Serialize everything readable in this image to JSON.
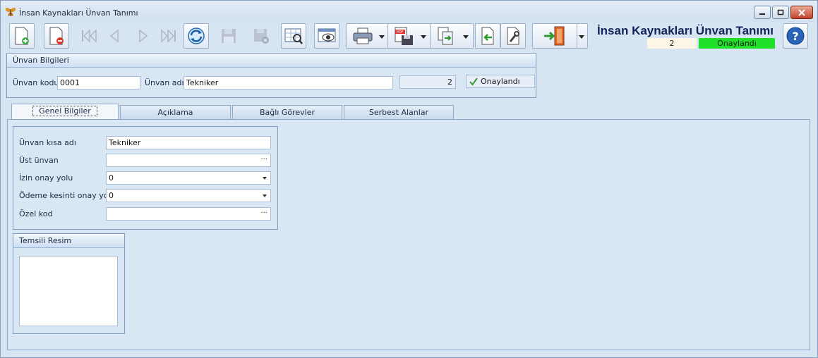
{
  "window": {
    "title": "İnsan Kaynakları Ünvan Tanımı"
  },
  "header": {
    "title": "İnsan Kaynakları Ünvan Tanımı",
    "record_count": "2",
    "status": "Onaylandı"
  },
  "toolbar": {
    "icons": [
      "new-document-icon",
      "delete-document-icon",
      "first-record-icon",
      "previous-record-icon",
      "next-record-icon",
      "last-record-icon",
      "refresh-icon",
      "save-disabled-icon",
      "save-cancel-disabled-icon",
      "find-record-icon",
      "preview-icon",
      "print-icon",
      "export-pdf-icon",
      "copy-transfer-icon",
      "back-arrow-icon",
      "tools-icon",
      "exit-door-icon",
      "help-icon"
    ]
  },
  "unvan_bilgileri": {
    "group_title": "Ünvan Bilgileri",
    "code_label": "Ünvan kodu",
    "code_value": "0001",
    "name_label": "Ünvan adı",
    "name_value": "Tekniker",
    "number_value": "2",
    "approved_label": "Onaylandı"
  },
  "tabs": [
    {
      "label": "Genel Bilgiler",
      "active": true
    },
    {
      "label": "Açıklama",
      "active": false
    },
    {
      "label": "Bağlı Görevler",
      "active": false
    },
    {
      "label": "Serbest Alanlar",
      "active": false
    }
  ],
  "genel": {
    "short_name_label": "Ünvan kısa adı",
    "short_name_value": "Tekniker",
    "parent_label": "Üst ünvan",
    "parent_value": "",
    "leave_label": "İzin onay yolu",
    "leave_value": "0",
    "payment_label": "Ödeme kesinti onay yolu",
    "payment_value": "0",
    "special_label": "Özel kod",
    "special_value": ""
  },
  "image_group": {
    "title": "Temsili Resim"
  },
  "colors": {
    "approved_green": "#22e02a",
    "header_blue": "#11245a"
  }
}
